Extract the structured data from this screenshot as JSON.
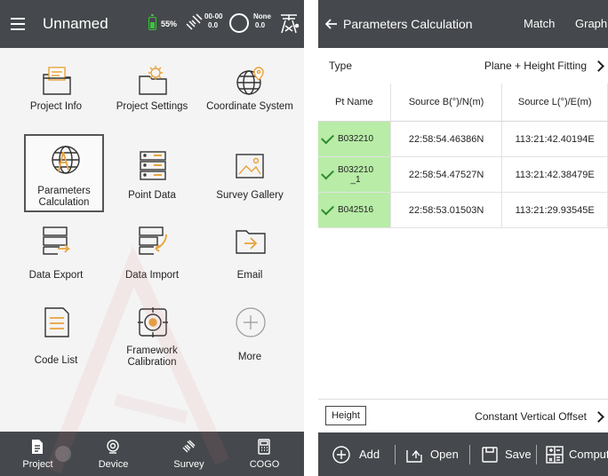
{
  "left": {
    "title": "Unnamed",
    "battery": "55%",
    "sat_top": "00-00",
    "sat_bottom": "0.0",
    "diff_top": "None",
    "diff_bottom": "0.0",
    "tiles": [
      {
        "label": "Project Info",
        "icon": "folder-doc-icon"
      },
      {
        "label": "Project Settings",
        "icon": "folder-settings-icon"
      },
      {
        "label": "Coordinate System",
        "icon": "globe-pin-icon"
      },
      {
        "label": "Parameters Calculation",
        "icon": "globe-compass-icon"
      },
      {
        "label": "Point Data",
        "icon": "server-icon"
      },
      {
        "label": "Survey Gallery",
        "icon": "image-icon"
      },
      {
        "label": "Data Export",
        "icon": "export-icon"
      },
      {
        "label": "Data Import",
        "icon": "import-icon"
      },
      {
        "label": "Email",
        "icon": "mail-folder-icon"
      },
      {
        "label": "Code List",
        "icon": "list-doc-icon"
      },
      {
        "label": "Framework Calibration",
        "icon": "target-icon"
      },
      {
        "label": "More",
        "icon": "plus-circle-icon"
      }
    ],
    "nav": [
      "Project",
      "Device",
      "Survey",
      "COGO"
    ]
  },
  "right": {
    "title": "Parameters Calculation",
    "match": "Match",
    "graph": "Graph",
    "type_label": "Type",
    "type_value": "Plane + Height Fitting",
    "columns": [
      "Pt Name",
      "Source B(°)/N(m)",
      "Source L(°)/E(m)"
    ],
    "rows": [
      {
        "name": "B032210",
        "b": "22:58:54.46386N",
        "l": "113:21:42.40194E"
      },
      {
        "name": "B032210\n_1",
        "b": "22:58:54.47527N",
        "l": "113:21:42.38479E"
      },
      {
        "name": "B042516",
        "b": "22:58:53.01503N",
        "l": "113:21:29.93545E"
      }
    ],
    "height_label": "Height",
    "height_value": "Constant Vertical Offset",
    "actions": [
      "Add",
      "Open",
      "Save",
      "Compute"
    ]
  },
  "colors": {
    "bar": "#45484c",
    "accent_green": "#b8eca7",
    "battery": "#3ec23e"
  }
}
